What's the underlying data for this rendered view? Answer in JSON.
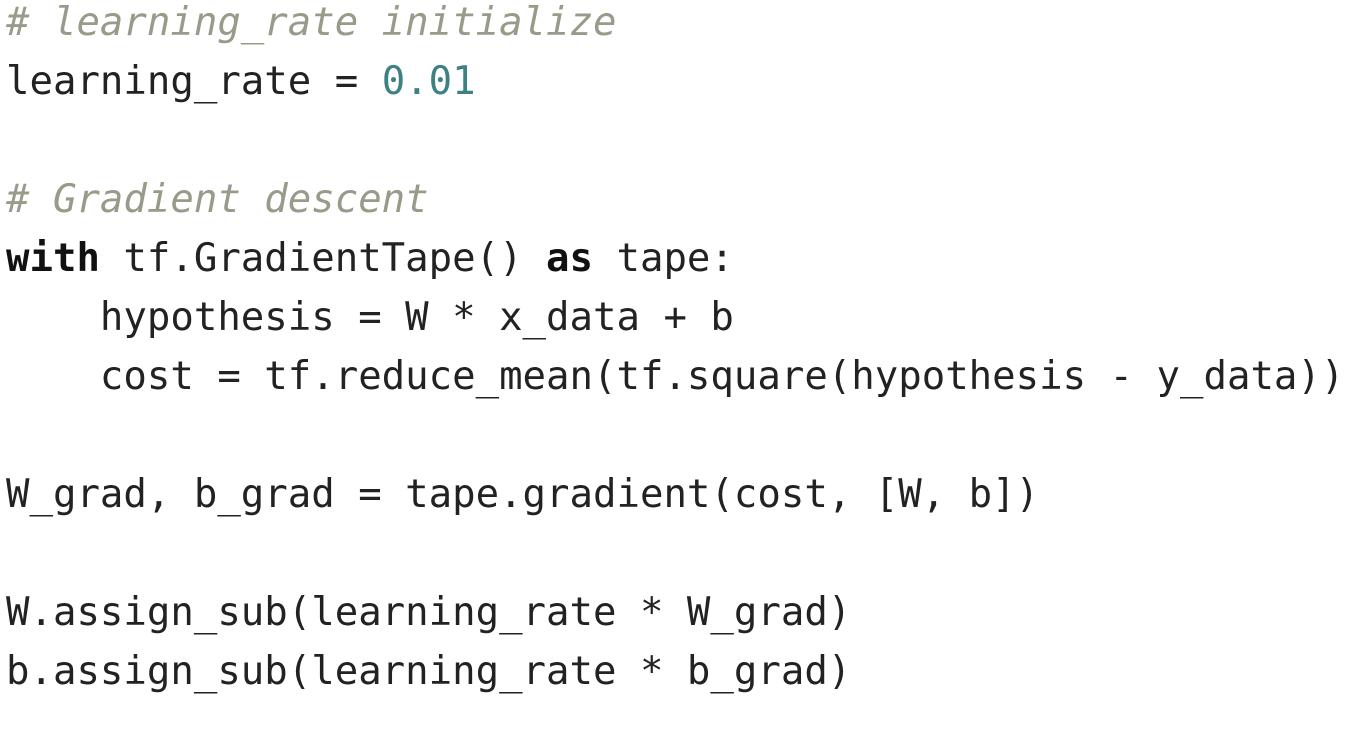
{
  "colors": {
    "comment": "#9a9a8a",
    "number": "#3d8183",
    "keyword": "#111111",
    "text": "#222222",
    "background": "#ffffff"
  },
  "code": {
    "lines": [
      {
        "tokens": [
          {
            "type": "comment",
            "text": "# learning_rate initialize"
          }
        ]
      },
      {
        "tokens": [
          {
            "type": "plain",
            "text": "learning_rate = "
          },
          {
            "type": "number",
            "text": "0.01"
          }
        ]
      },
      {
        "tokens": []
      },
      {
        "tokens": [
          {
            "type": "comment",
            "text": "# Gradient descent"
          }
        ]
      },
      {
        "tokens": [
          {
            "type": "keyword",
            "text": "with"
          },
          {
            "type": "plain",
            "text": " tf.GradientTape() "
          },
          {
            "type": "keyword",
            "text": "as"
          },
          {
            "type": "plain",
            "text": " tape:"
          }
        ]
      },
      {
        "tokens": [
          {
            "type": "plain",
            "text": "    hypothesis = W * x_data + b"
          }
        ]
      },
      {
        "tokens": [
          {
            "type": "plain",
            "text": "    cost = tf.reduce_mean(tf.square(hypothesis - y_data))"
          }
        ]
      },
      {
        "tokens": []
      },
      {
        "tokens": [
          {
            "type": "plain",
            "text": "W_grad, b_grad = tape.gradient(cost, [W, b])"
          }
        ]
      },
      {
        "tokens": []
      },
      {
        "tokens": [
          {
            "type": "plain",
            "text": "W.assign_sub(learning_rate * W_grad)"
          }
        ]
      },
      {
        "tokens": [
          {
            "type": "plain",
            "text": "b.assign_sub(learning_rate * b_grad)"
          }
        ]
      }
    ]
  }
}
